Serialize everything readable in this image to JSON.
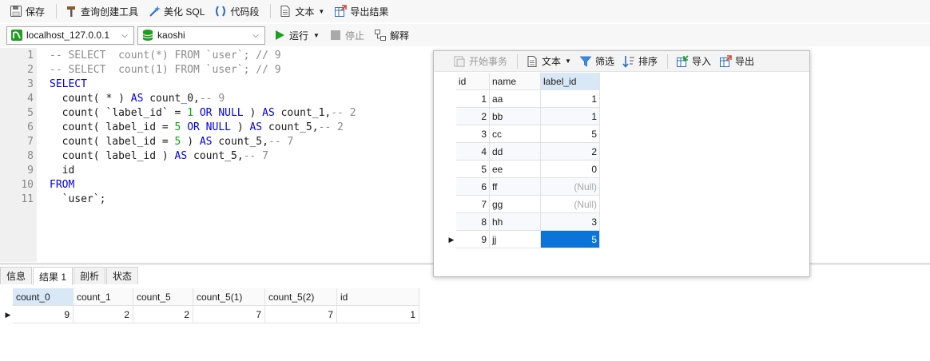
{
  "toolbar1": {
    "save": "保存",
    "query_builder": "查询创建工具",
    "beautify": "美化 SQL",
    "snippet": "代码段",
    "text": "文本",
    "export": "导出结果"
  },
  "toolbar2": {
    "connection": "localhost_127.0.0.1",
    "database": "kaoshi",
    "run": "运行",
    "stop": "停止",
    "explain": "解释"
  },
  "editor": {
    "line_numbers": [
      "1",
      "2",
      "3",
      "4",
      "5",
      "6",
      "7",
      "8",
      "9",
      "10",
      "11"
    ]
  },
  "float_toolbar": {
    "begin_tx": "开始事务",
    "text": "文本",
    "filter": "筛选",
    "sort": "排序",
    "import": "导入",
    "export": "导出"
  },
  "float_grid": {
    "headers": [
      "id",
      "name",
      "label_id"
    ],
    "rows": [
      [
        "1",
        "aa",
        "1"
      ],
      [
        "2",
        "bb",
        "1"
      ],
      [
        "3",
        "cc",
        "5"
      ],
      [
        "4",
        "dd",
        "2"
      ],
      [
        "5",
        "ee",
        "0"
      ],
      [
        "6",
        "ff",
        "(Null)"
      ],
      [
        "7",
        "gg",
        "(Null)"
      ],
      [
        "8",
        "hh",
        "3"
      ],
      [
        "9",
        "jj",
        "5"
      ]
    ]
  },
  "bottom_tabs": [
    "信息",
    "结果 1",
    "剖析",
    "状态"
  ],
  "result_grid": {
    "headers": [
      "count_0",
      "count_1",
      "count_5",
      "count_5(1)",
      "count_5(2)",
      "id"
    ],
    "rows": [
      [
        "9",
        "2",
        "2",
        "7",
        "7",
        "1"
      ]
    ]
  },
  "colors": {
    "keyword": "#0000ee",
    "comment": "#8b8b8b",
    "number": "#0aa80a",
    "selection": "#0a74d8",
    "run_green": "#1e9e1e",
    "header_selected": "#d9e8f7"
  }
}
